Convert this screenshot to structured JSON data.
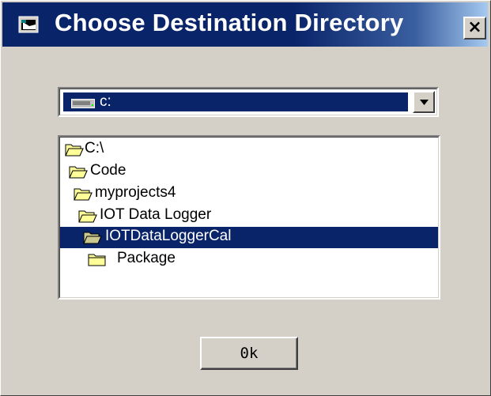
{
  "window": {
    "title": "Choose Destination Directory",
    "close_label": "×"
  },
  "drive": {
    "selected": "c:",
    "icon": "drive-icon"
  },
  "directory_tree": {
    "items": [
      {
        "label": "C:\\",
        "icon": "open-folder-icon",
        "selected": false
      },
      {
        "label": "Code",
        "icon": "open-folder-icon",
        "selected": false
      },
      {
        "label": "myprojects4",
        "icon": "open-folder-icon",
        "selected": false
      },
      {
        "label": "IOT Data Logger",
        "icon": "open-folder-icon",
        "selected": false
      },
      {
        "label": "IOTDataLoggerCal",
        "icon": "open-folder-icon",
        "selected": true
      },
      {
        "label": "Package",
        "icon": "closed-folder-icon",
        "selected": false
      }
    ]
  },
  "buttons": {
    "ok_label": "0k"
  },
  "colors": {
    "face": "#d4d0c8",
    "title_bar": "#0a246a",
    "selection": "#0a246a",
    "folder": "#ffff99"
  }
}
